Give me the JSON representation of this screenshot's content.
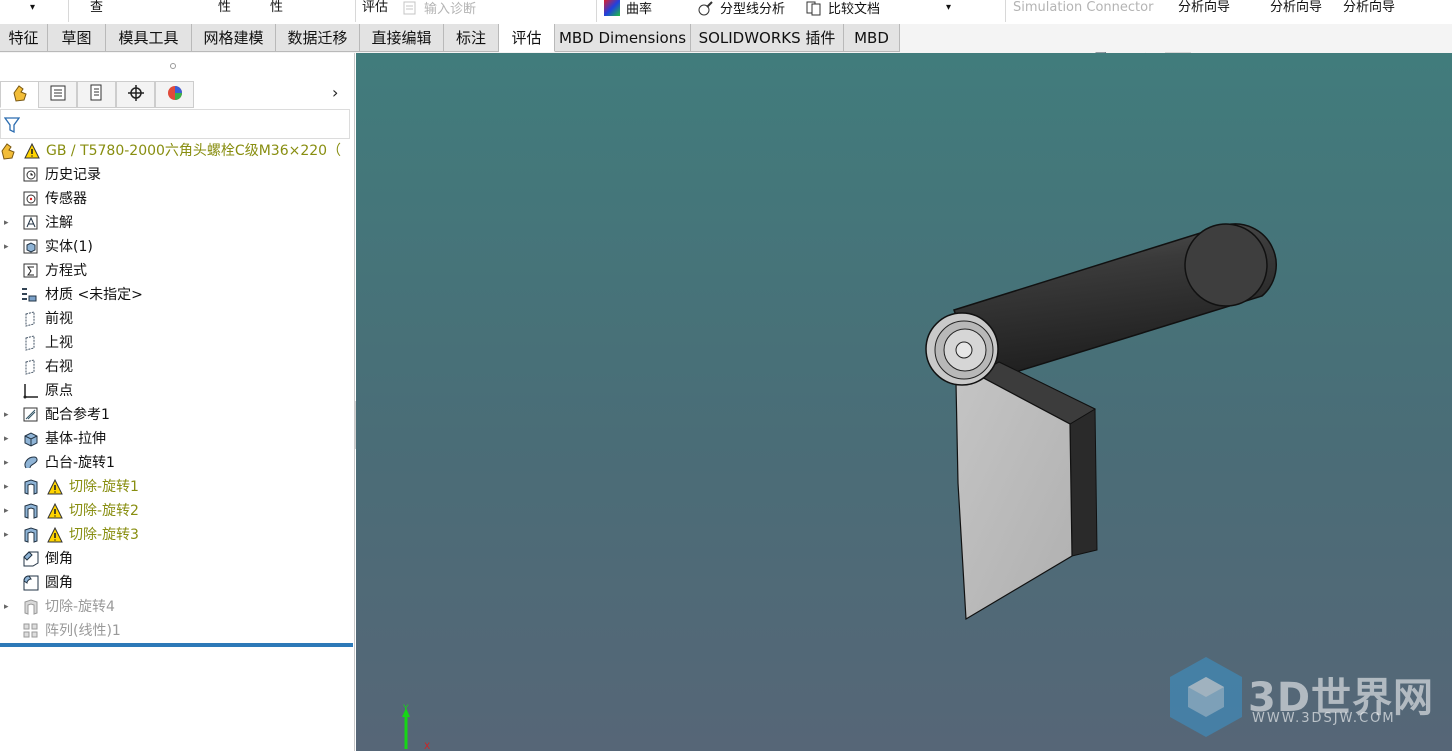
{
  "ribbon": {
    "dropdown_arrow": "▾",
    "item_cha": "查",
    "item_xing1": "性",
    "item_xing2": "性",
    "item_pinggu": "评估",
    "item_input_diag": "输入诊断",
    "item_curvature": "曲率",
    "item_parting": "分型线分析",
    "item_compare": "比较文档",
    "item_sim": "Simulation Connector",
    "wizard1": "分析向导",
    "wizard2": "分析向导",
    "wizard3": "分析向导"
  },
  "tabs": [
    {
      "label": "特征"
    },
    {
      "label": "草图"
    },
    {
      "label": "模具工具"
    },
    {
      "label": "网格建模"
    },
    {
      "label": "数据迁移"
    },
    {
      "label": "直接编辑"
    },
    {
      "label": "标注"
    },
    {
      "label": "评估",
      "active": true
    },
    {
      "label": "MBD Dimensions"
    },
    {
      "label": "SOLIDWORKS 插件"
    },
    {
      "label": "MBD"
    }
  ],
  "panel": {
    "more_glyph": "›",
    "root": "GB / T5780-2000六角头螺栓C级M36×220（",
    "items": [
      {
        "label": "历史记录",
        "icon": "history-icon"
      },
      {
        "label": "传感器",
        "icon": "sensor-icon"
      },
      {
        "label": "注解",
        "icon": "annotation-icon",
        "expandable": true
      },
      {
        "label": "实体(1)",
        "icon": "solid-bodies-icon",
        "expandable": true
      },
      {
        "label": "方程式",
        "icon": "equation-icon"
      },
      {
        "label": "材质 <未指定>",
        "icon": "material-icon"
      },
      {
        "label": "前视",
        "icon": "plane-icon"
      },
      {
        "label": "上视",
        "icon": "plane-icon"
      },
      {
        "label": "右视",
        "icon": "plane-icon"
      },
      {
        "label": "原点",
        "icon": "origin-icon"
      },
      {
        "label": "配合参考1",
        "icon": "mate-reference-icon",
        "expandable": true
      },
      {
        "label": "基体-拉伸",
        "icon": "extrude-icon",
        "expandable": true
      },
      {
        "label": "凸台-旋转1",
        "icon": "revolve-icon",
        "expandable": true
      },
      {
        "label": "切除-旋转1",
        "icon": "cut-revolve-icon",
        "expandable": true,
        "warning": true
      },
      {
        "label": "切除-旋转2",
        "icon": "cut-revolve-icon",
        "expandable": true,
        "warning": true
      },
      {
        "label": "切除-旋转3",
        "icon": "cut-revolve-icon",
        "expandable": true,
        "warning": true
      },
      {
        "label": "倒角",
        "icon": "chamfer-icon"
      },
      {
        "label": "圆角",
        "icon": "fillet-icon"
      },
      {
        "label": "切除-旋转4",
        "icon": "cut-revolve-icon",
        "expandable": true,
        "suppressed": true
      },
      {
        "label": "阵列(线性)1",
        "icon": "linear-pattern-icon",
        "suppressed": true
      }
    ]
  },
  "viewport": {
    "triad_y": "Y",
    "triad_x": "X"
  },
  "watermark": {
    "title": "3D世界网",
    "url": "WWW.3DSJW.COM"
  },
  "colors": {
    "active_tab": "#ffffff",
    "warning_text": "#888e10",
    "rollback_bar": "#2d79b8",
    "viewport_top": "#417c7c",
    "viewport_bottom": "#566677"
  }
}
